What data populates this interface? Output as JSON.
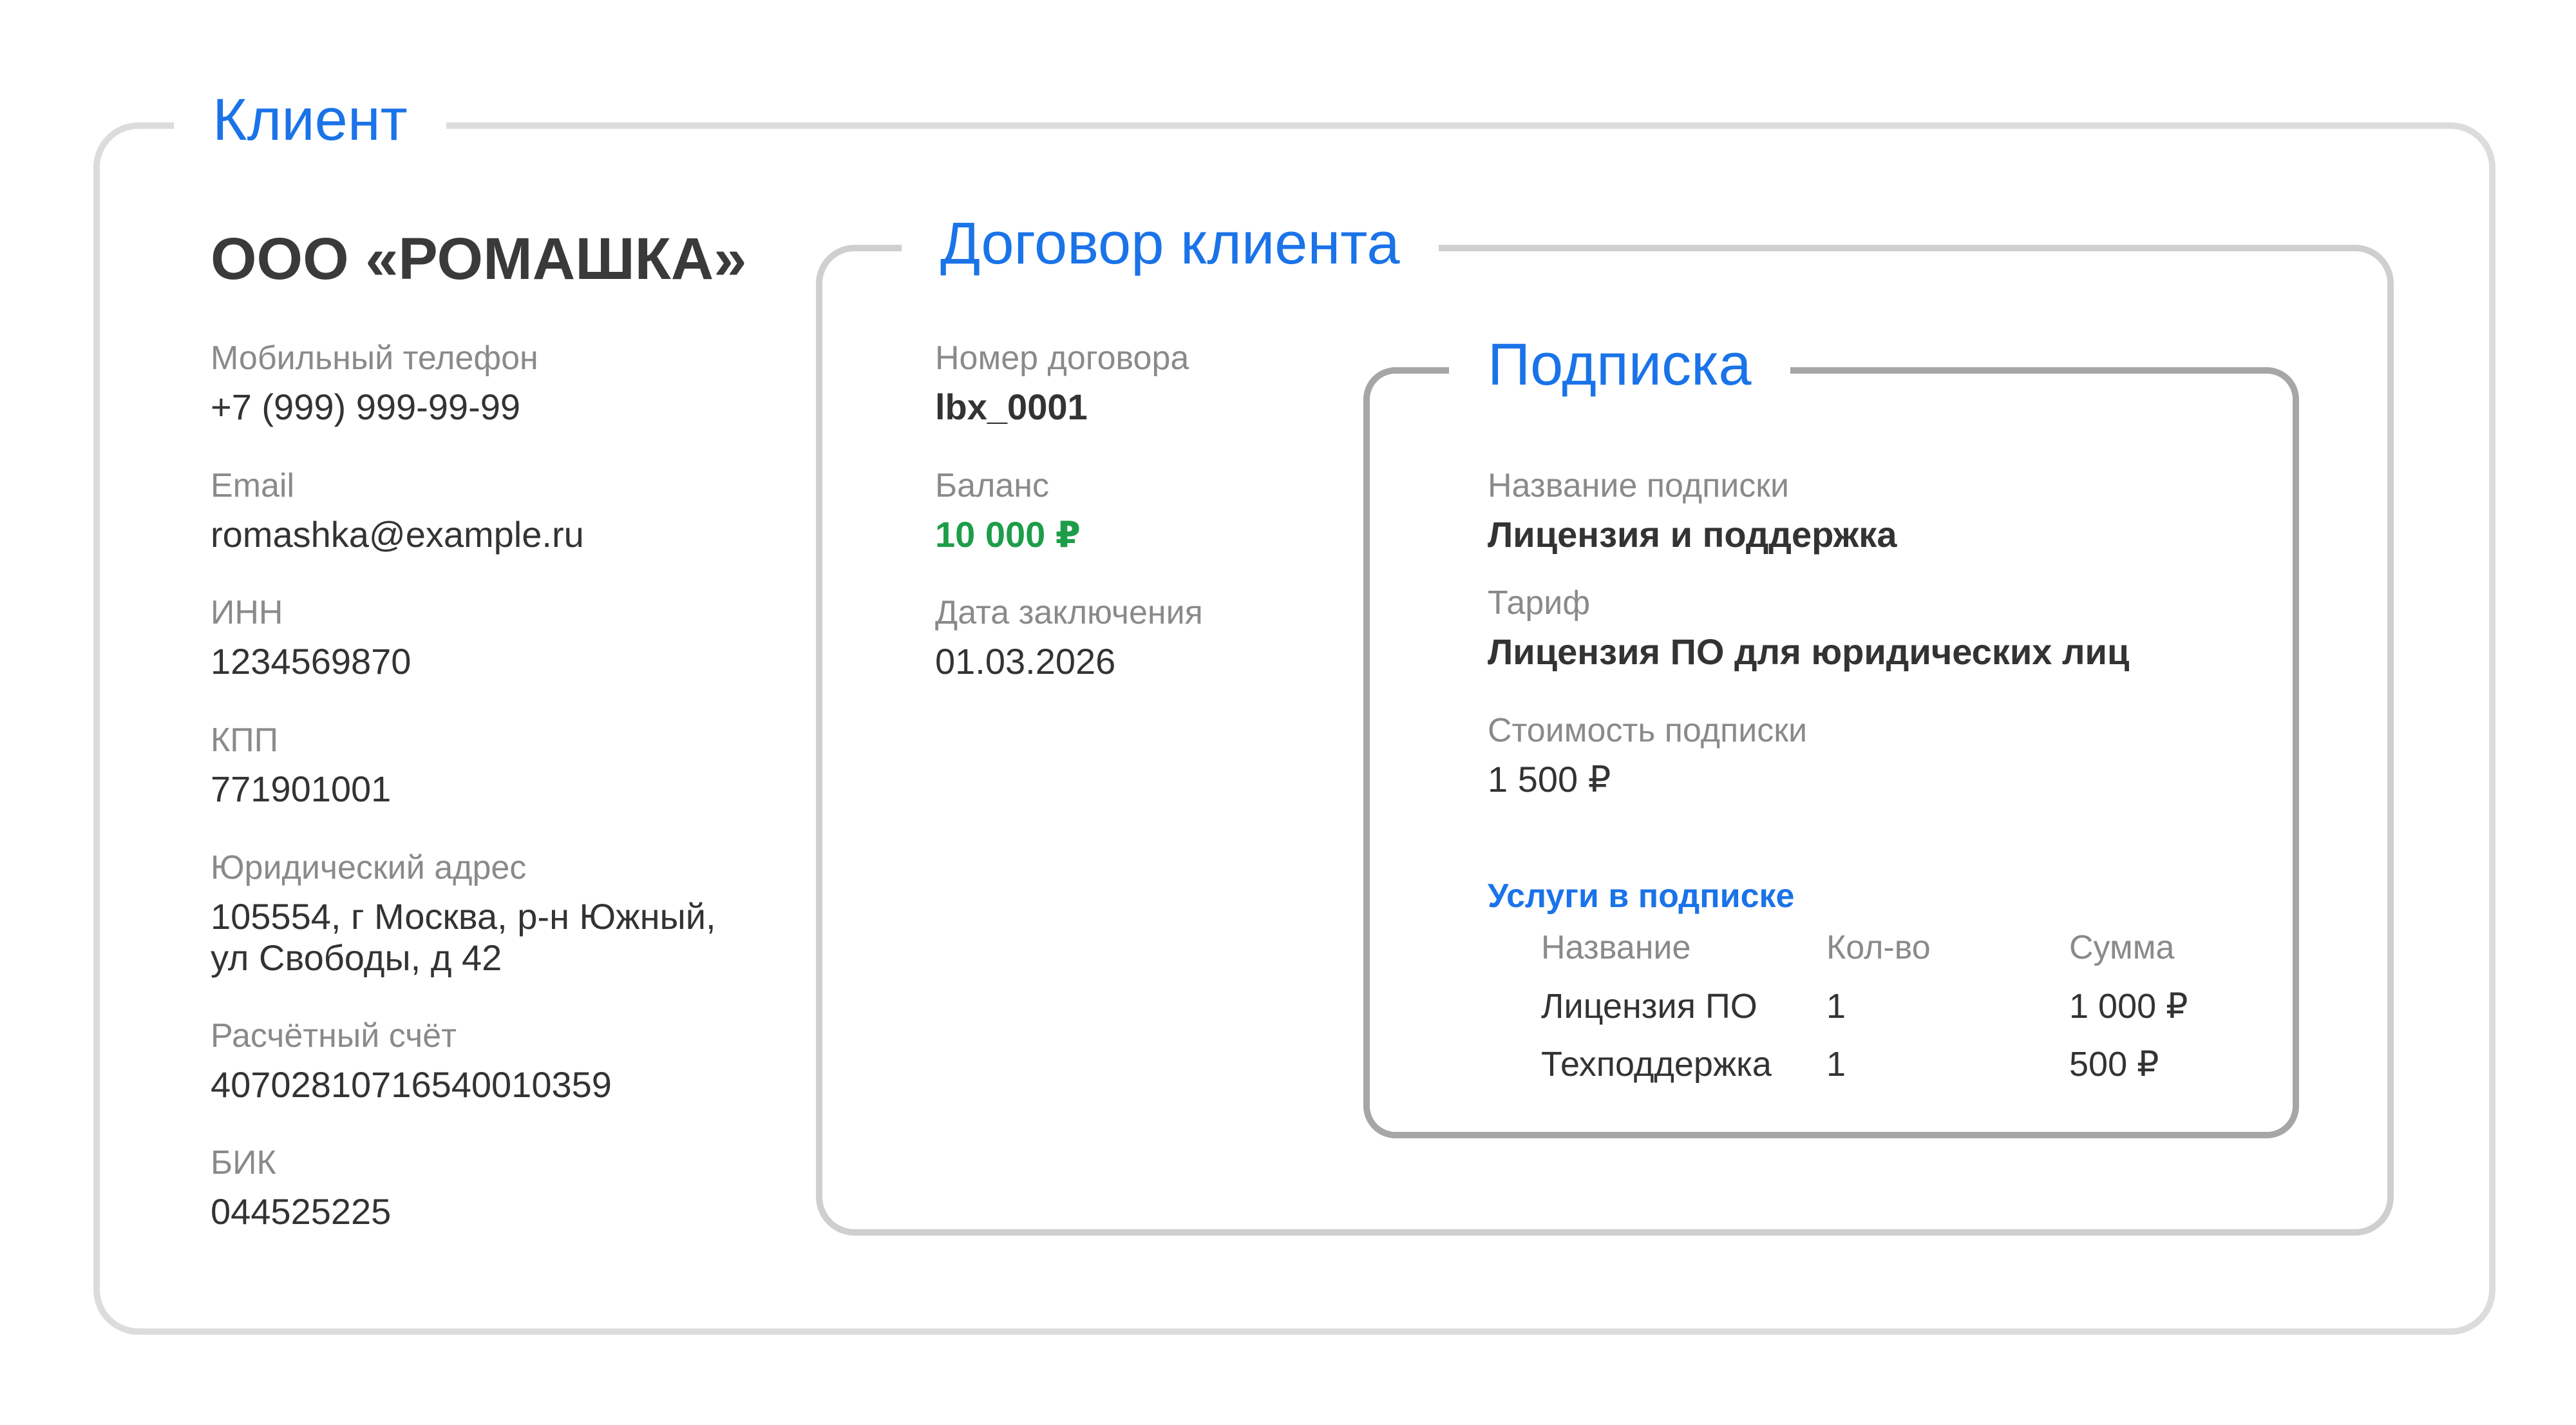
{
  "client": {
    "legend": "Клиент",
    "company": "ООО «РОМАШКА»",
    "fields": [
      {
        "label": "Мобильный телефон",
        "value": "+7 (999) 999-99-99"
      },
      {
        "label": "Email",
        "value": "romashka@example.ru"
      },
      {
        "label": "ИНН",
        "value": "1234569870"
      },
      {
        "label": "КПП",
        "value": "771901001"
      },
      {
        "label": "Юридический адрес",
        "value_line1": "105554, г Москва, р-н Южный,",
        "value_line2": "ул Свободы, д 42"
      },
      {
        "label": "Расчётный счёт",
        "value": "40702810716540010359"
      },
      {
        "label": "БИК",
        "value": "044525225"
      }
    ]
  },
  "contract": {
    "legend": "Договор клиента",
    "number_label": "Номер договора",
    "number_value": "lbx_0001",
    "balance_label": "Баланс",
    "balance_value": "10 000 ₽",
    "balance_color": "#1e9d49",
    "date_label": "Дата заключения",
    "date_value": "01.03.2026"
  },
  "subscription": {
    "legend": "Подписка",
    "name_label": "Название подписки",
    "name_value": "Лицензия и поддержка",
    "tariff_label": "Тариф",
    "tariff_value": "Лицензия ПО для юридических лиц",
    "cost_label": "Стоимость подписки",
    "cost_value": "1 500 ₽",
    "services": {
      "title": "Услуги в подписке",
      "columns": [
        "Название",
        "Кол-во",
        "Сумма"
      ],
      "rows": [
        [
          "Лицензия ПО",
          "1",
          "1 000 ₽"
        ],
        [
          "Техподдержка",
          "1",
          "500 ₽"
        ]
      ]
    }
  },
  "colors": {
    "accent": "#1a73e8",
    "balance": "#1e9d49"
  }
}
